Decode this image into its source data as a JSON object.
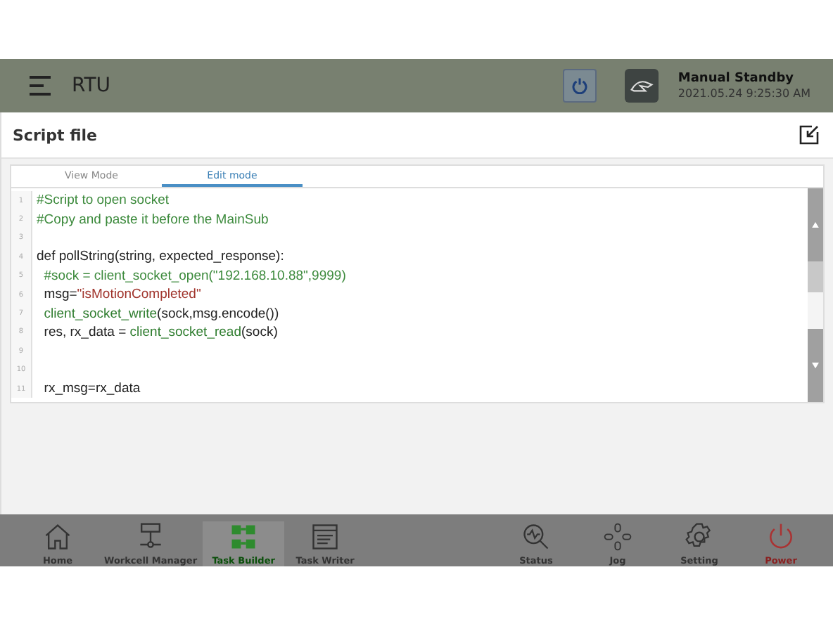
{
  "header": {
    "title": "RTU",
    "status": "Manual Standby",
    "timestamp": "2021.05.24 9:25:30 AM"
  },
  "panel": {
    "title": "Script file"
  },
  "tabs": [
    {
      "label": "View Mode",
      "selected": false
    },
    {
      "label": "Edit mode",
      "selected": true
    }
  ],
  "editor": {
    "lines": [
      {
        "number": "1",
        "tokens": [
          {
            "text": "#Script to open socket",
            "kind": "comment"
          }
        ]
      },
      {
        "number": "2",
        "tokens": [
          {
            "text": "#Copy and paste it before the MainSub",
            "kind": "comment"
          }
        ]
      },
      {
        "number": "3"
      },
      {
        "number": "4",
        "tokens": [
          {
            "text": "def",
            "kind": "keyword"
          },
          {
            "text": " pollString(string, expected_response):",
            "kind": "plain"
          }
        ]
      },
      {
        "number": "5",
        "tokens": [
          {
            "text": "  #sock = client_socket_open(\"192.168.10.88\",9999)",
            "kind": "comment"
          }
        ]
      },
      {
        "number": "6",
        "tokens": [
          {
            "text": "  msg=",
            "kind": "plain"
          },
          {
            "text": "\"isMotionCompleted\"",
            "kind": "string"
          }
        ]
      },
      {
        "number": "7",
        "tokens": [
          {
            "text": "  client_socket_write",
            "kind": "call"
          },
          {
            "text": "(sock,msg.encode())",
            "kind": "plain"
          }
        ]
      },
      {
        "number": "8",
        "tokens": [
          {
            "text": "  res, rx_data = ",
            "kind": "plain"
          },
          {
            "text": "client_socket_read",
            "kind": "call"
          },
          {
            "text": "(sock)",
            "kind": "plain"
          }
        ]
      },
      {
        "number": "9"
      },
      {
        "number": "10"
      },
      {
        "number": "11",
        "tokens": [
          {
            "text": "  rx_msg=rx_data",
            "kind": "plain"
          }
        ]
      }
    ]
  },
  "nav": [
    {
      "label": "Home",
      "kind": "home",
      "selected": false
    },
    {
      "label": "Workcell Manager",
      "kind": "network",
      "selected": false
    },
    {
      "label": "Task Builder",
      "kind": "blocks",
      "selected": true
    },
    {
      "label": "Task Writer",
      "kind": "document",
      "selected": false
    },
    {
      "label": "Status",
      "kind": "status",
      "selected": false
    },
    {
      "label": "Jog",
      "kind": "jog",
      "selected": false
    },
    {
      "label": "Setting",
      "kind": "gear",
      "selected": false
    },
    {
      "label": "Power",
      "kind": "power",
      "selected": false
    }
  ]
}
